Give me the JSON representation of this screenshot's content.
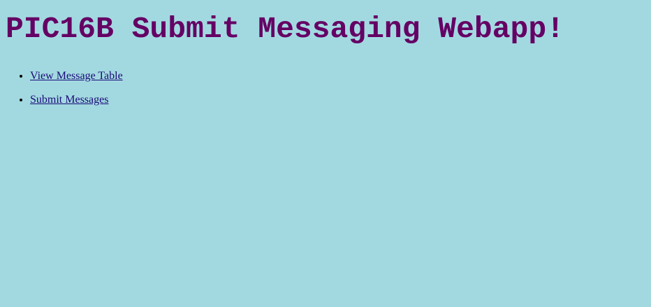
{
  "page": {
    "title": "PIC16B Submit Messaging Webapp!"
  },
  "nav": {
    "items": [
      {
        "label": "View Message Table"
      },
      {
        "label": "Submit Messages"
      }
    ]
  },
  "colors": {
    "background": "#a2d9e0",
    "title": "#650064",
    "link": "#1a0a78"
  }
}
